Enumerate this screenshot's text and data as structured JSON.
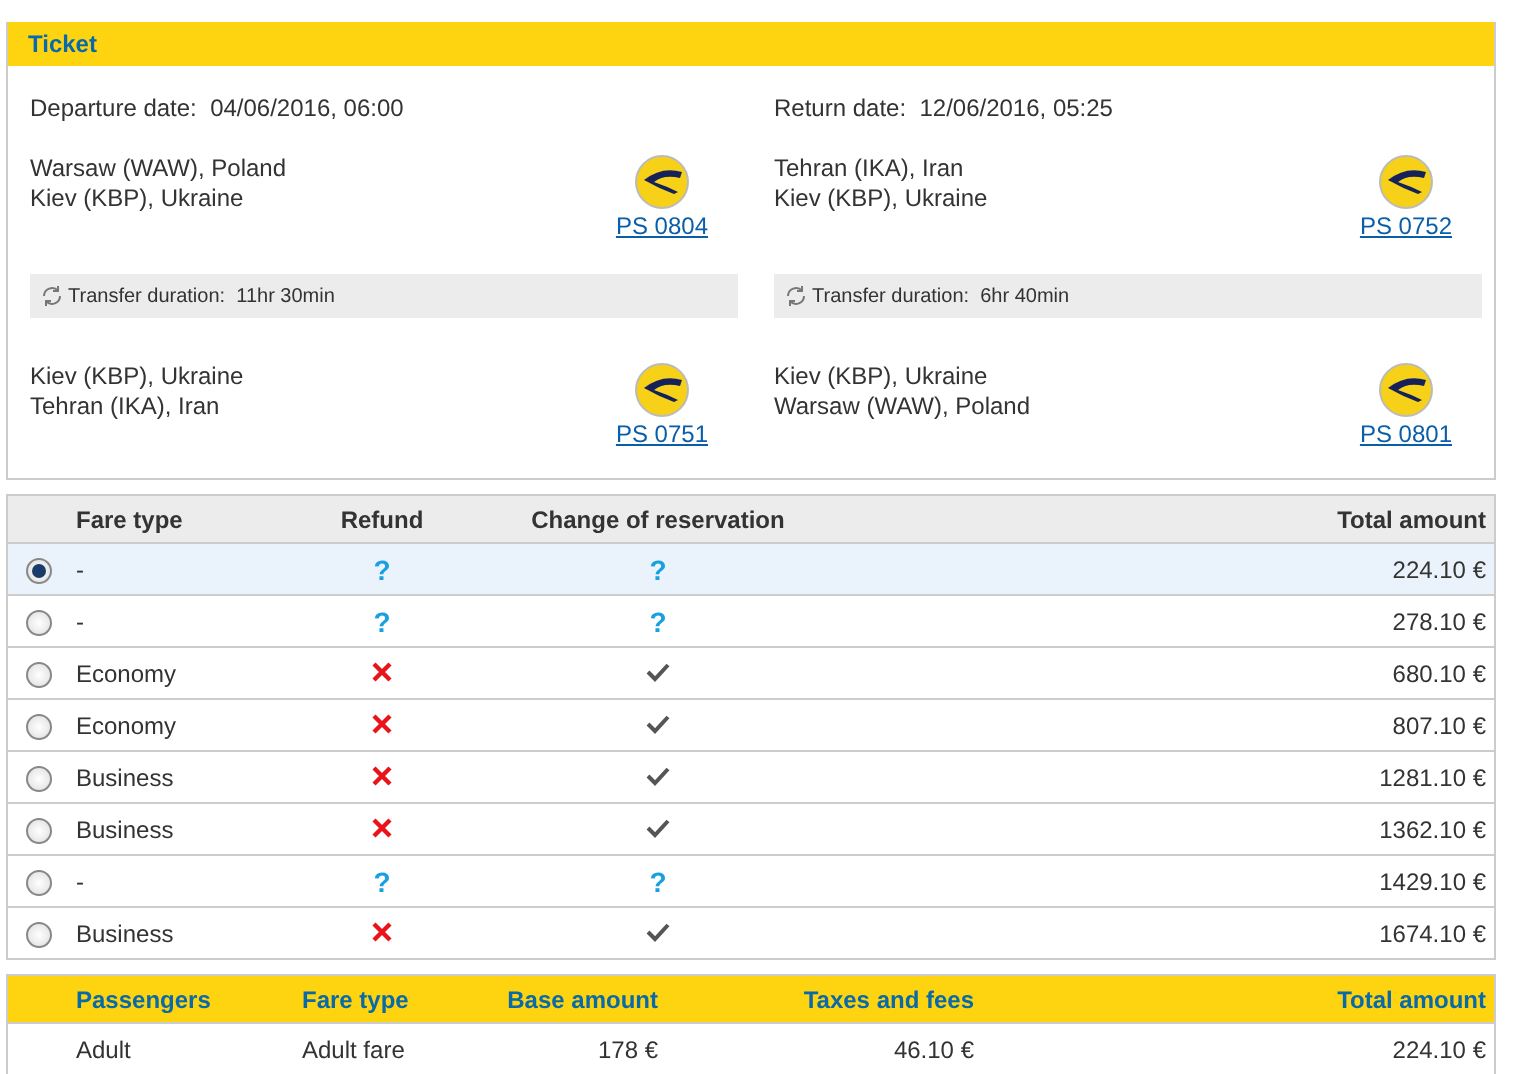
{
  "ticket": {
    "title": "Ticket",
    "directions": [
      {
        "date_label": "Departure date:",
        "date": "04/06/2016, 06:00",
        "segments": [
          {
            "from": "Warsaw (WAW), Poland",
            "to": "Kiev (KBP), Ukraine",
            "flight": "PS 0804"
          },
          {
            "from": "Kiev (KBP), Ukraine",
            "to": "Tehran (IKA), Iran",
            "flight": "PS 0751"
          }
        ],
        "transfer_label": "Transfer duration:",
        "transfer": "11hr 30min"
      },
      {
        "date_label": "Return date:",
        "date": "12/06/2016, 05:25",
        "segments": [
          {
            "from": "Tehran (IKA), Iran",
            "to": "Kiev (KBP), Ukraine",
            "flight": "PS 0752"
          },
          {
            "from": "Kiev (KBP), Ukraine",
            "to": "Warsaw (WAW), Poland",
            "flight": "PS 0801"
          }
        ],
        "transfer_label": "Transfer duration:",
        "transfer": "6hr 40min"
      }
    ]
  },
  "fares": {
    "columns": [
      "Fare type",
      "Refund",
      "Change of reservation",
      "Total amount"
    ],
    "rows": [
      {
        "selected": true,
        "fare_type": "-",
        "refund": {
          "kind": "text",
          "text": "?"
        },
        "change": {
          "kind": "text",
          "text": "?"
        },
        "total": "224.10 €"
      },
      {
        "selected": false,
        "fare_type": "-",
        "refund": {
          "kind": "text",
          "text": "?"
        },
        "change": {
          "kind": "text",
          "text": "?"
        },
        "total": "278.10 €"
      },
      {
        "selected": false,
        "fare_type": "Economy",
        "refund": {
          "kind": "cross"
        },
        "change": {
          "kind": "check"
        },
        "total": "680.10 €"
      },
      {
        "selected": false,
        "fare_type": "Economy",
        "refund": {
          "kind": "cross"
        },
        "change": {
          "kind": "check"
        },
        "total": "807.10 €"
      },
      {
        "selected": false,
        "fare_type": "Business",
        "refund": {
          "kind": "cross"
        },
        "change": {
          "kind": "check"
        },
        "total": "1281.10 €"
      },
      {
        "selected": false,
        "fare_type": "Business",
        "refund": {
          "kind": "cross"
        },
        "change": {
          "kind": "check"
        },
        "total": "1362.10 €"
      },
      {
        "selected": false,
        "fare_type": "-",
        "refund": {
          "kind": "text",
          "text": "?"
        },
        "change": {
          "kind": "text",
          "text": "?"
        },
        "total": "1429.10 €"
      },
      {
        "selected": false,
        "fare_type": "Business",
        "refund": {
          "kind": "cross"
        },
        "change": {
          "kind": "check"
        },
        "total": "1674.10 €"
      }
    ]
  },
  "passengers": {
    "columns": [
      "Passengers",
      "Fare type",
      "Base amount",
      "Taxes and fees",
      "Total amount"
    ],
    "rows": [
      {
        "passengers": "Adult",
        "fare_type": "Adult fare",
        "base": "178 €",
        "taxes": "46.10 €",
        "total": "224.10 €"
      }
    ]
  }
}
